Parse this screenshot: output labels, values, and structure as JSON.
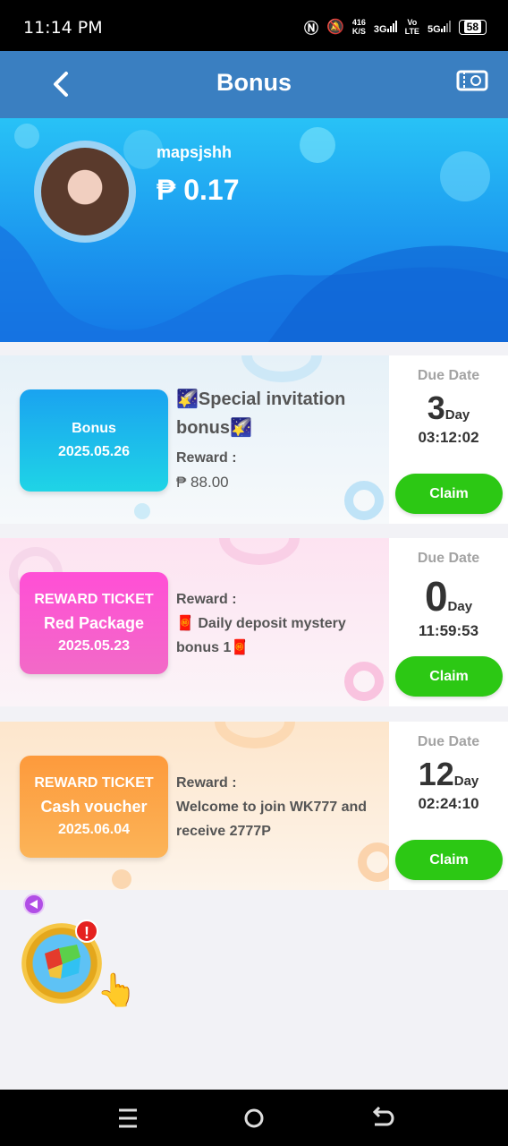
{
  "status_bar": {
    "time": "11:14 PM",
    "speed_value": "416",
    "speed_unit": "K/S",
    "net1": "3G",
    "net2_top": "Vo",
    "net2_bottom": "LTE",
    "net3": "5G",
    "battery": "58"
  },
  "header": {
    "title": "Bonus",
    "back_icon": "chevron-left-icon",
    "ticket_icon": "ticket-icon"
  },
  "profile": {
    "username": "mapsjshh",
    "balance": "₱ 0.17"
  },
  "bonus_cards": [
    {
      "badge_kind": "Bonus",
      "badge_sub": "",
      "badge_date": "2025.05.26",
      "title": "🌠Special invitation bonus🌠",
      "reward_label": "Reward :",
      "reward_text": "₱ 88.00",
      "due_label": "Due Date",
      "due_days": "3",
      "due_unit": "Day",
      "due_time": "03:12:02",
      "claim": "Claim"
    },
    {
      "badge_kind": "REWARD TICKET",
      "badge_sub": "Red Package",
      "badge_date": "2025.05.23",
      "reward_label": "Reward :",
      "reward_text": "🧧 Daily deposit mystery bonus 1🧧",
      "due_label": "Due Date",
      "due_days": "0",
      "due_unit": "Day",
      "due_time": "11:59:53",
      "claim": "Claim"
    },
    {
      "badge_kind": "REWARD TICKET",
      "badge_sub": "Cash voucher",
      "badge_date": "2025.06.04",
      "reward_label": "Reward :",
      "reward_text": "Welcome to join WK777 and receive 2777P",
      "due_label": "Due Date",
      "due_days": "12",
      "due_unit": "Day",
      "due_time": "02:24:10",
      "claim": "Claim"
    }
  ],
  "floating": {
    "alert": "!",
    "hand_icon": "pointing-hand-icon",
    "gift_icon": "gift-box-icon"
  },
  "colors": {
    "appbar": "#3a7fc1",
    "claim": "#2cc814",
    "bonus_badge": "#1aa3f0",
    "red_package": "#ff4fd6",
    "cash_voucher": "#fd9a3c"
  }
}
